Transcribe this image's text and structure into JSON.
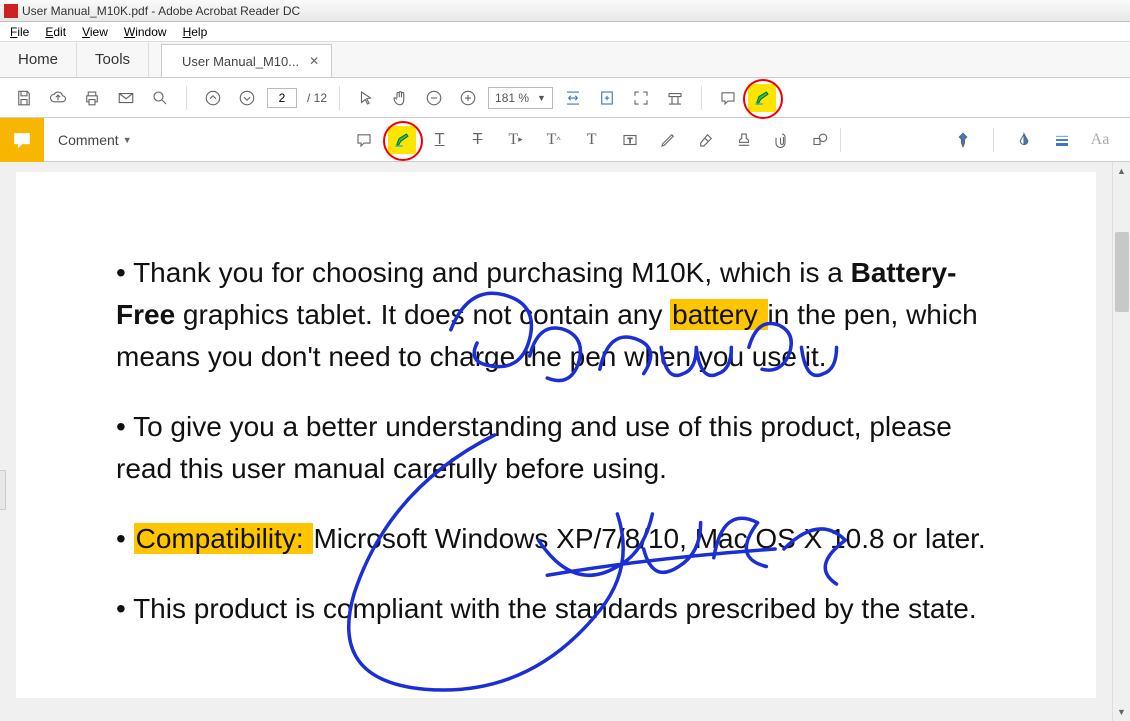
{
  "title": "User Manual_M10K.pdf - Adobe Acrobat Reader DC",
  "menu": {
    "file": "File",
    "edit": "Edit",
    "view": "View",
    "window": "Window",
    "help": "Help"
  },
  "tabs": {
    "home": "Home",
    "tools": "Tools",
    "doc": "User Manual_M10..."
  },
  "toolbar": {
    "page_current": "2",
    "page_total": "/ 12",
    "zoom": "181 %"
  },
  "comment_bar": {
    "label": "Comment"
  },
  "document": {
    "p1_a": "• Thank you for choosing and purchasing M10K, which is a ",
    "p1_bold": "Battery-Free",
    "p1_b": " graphics tablet. It does not contain any ",
    "p1_hl": "battery ",
    "p1_c": "in the pen, which means you don't need to charge the pen when you use it.",
    "p2": "• To give you a better understanding and use of this product, please read this user manual carefully before using.",
    "p3_a": "• ",
    "p3_hl": "Compatibility: ",
    "p3_b": "Microsoft Windows XP/7/8/10, Mac OS X 10.8 or later.",
    "p4": "• This product is compliant with the standards prescribed by the state."
  },
  "annotations": {
    "handwriting_1": "Gaomon",
    "handwriting_2": "Andre",
    "circled_tools": [
      "highlight-tool-main",
      "highlight-tool-comment"
    ],
    "highlighted_text": [
      "battery",
      "Compatibility:"
    ]
  }
}
